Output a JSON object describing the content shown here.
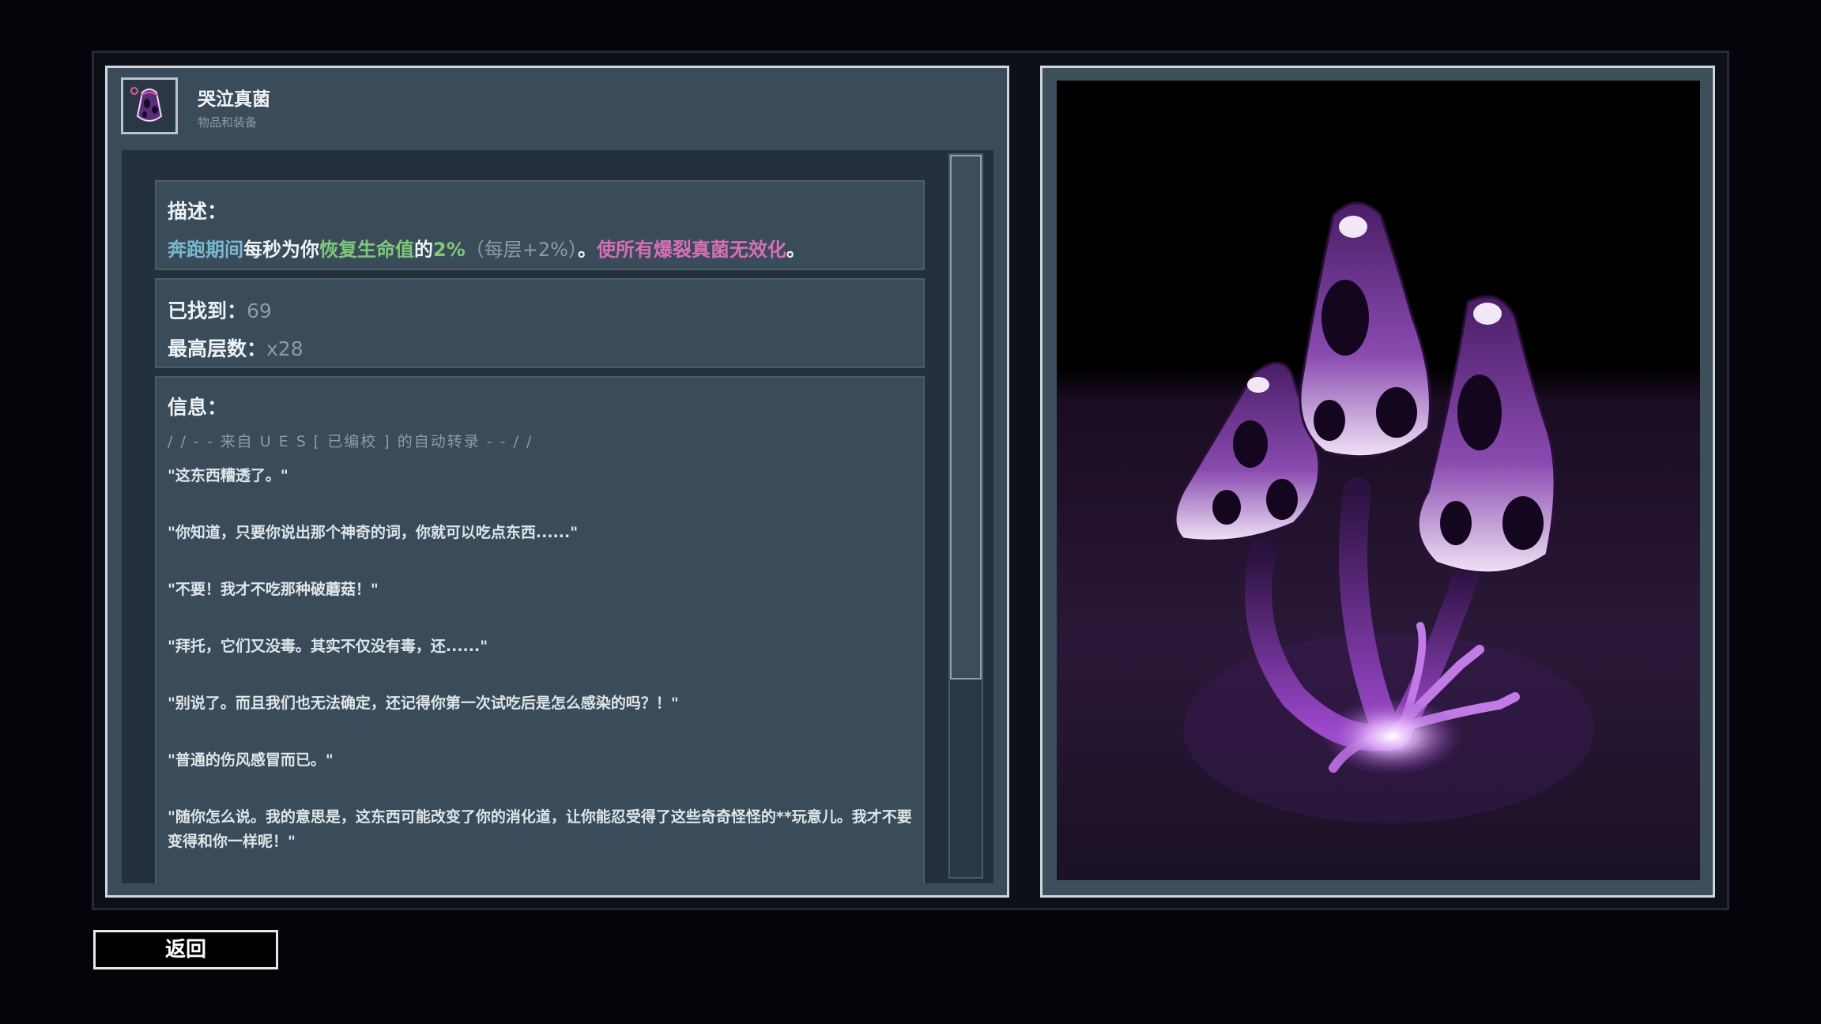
{
  "item": {
    "name": "哭泣真菌",
    "category": "物品和装备",
    "icon": "weeping-fungus-icon"
  },
  "description": {
    "title": "描述：",
    "segments": [
      {
        "text": "奔跑期间",
        "color": "#7ab8cf"
      },
      {
        "text": "每秒为你",
        "color": "#eef2f4"
      },
      {
        "text": "恢复生命值",
        "color": "#7fc87a"
      },
      {
        "text": "的",
        "color": "#eef2f4"
      },
      {
        "text": "2%",
        "color": "#7fc87a"
      },
      {
        "text": "（每层+2%）",
        "color": "#8d9ba6"
      },
      {
        "text": "。",
        "color": "#eef2f4"
      },
      {
        "text": "使所有爆裂真菌无效化",
        "color": "#d86fb6"
      },
      {
        "text": "。",
        "color": "#eef2f4"
      }
    ]
  },
  "stats": {
    "found_label": "已找到：",
    "found_value": "69",
    "max_stack_label": "最高层数：",
    "max_stack_value": "x28"
  },
  "info": {
    "title": "信息：",
    "header": "/ / - - 来自 U E S [ 已编校 ] 的自动转录 - - / /",
    "lines": [
      "\"这东西糟透了。\"",
      "\"你知道，只要你说出那个神奇的词，你就可以吃点东西......\"",
      "\"不要！我才不吃那种破蘑菇！\"",
      "\"拜托，它们又没毒。其实不仅没有毒，还......\"",
      "\"别说了。而且我们也无法确定，还记得你第一次试吃后是怎么感染的吗？！\"",
      "\"普通的伤风感冒而已。\"",
      "\"随你怎么说。我的意思是，这东西可能改变了你的消化道，让你能忍受得了这些奇奇怪怪的**玩意儿。我才不要变得和你一样呢！\""
    ]
  },
  "buttons": {
    "back": "返回"
  },
  "colors": {
    "panel": "#3a4b59",
    "accent_purple": "#8a3fb0"
  }
}
